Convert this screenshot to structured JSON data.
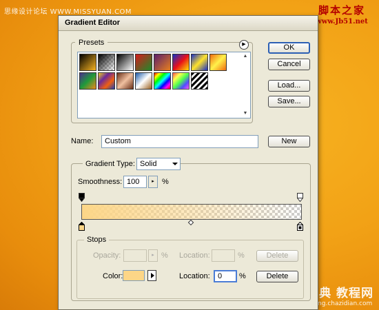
{
  "watermarks": {
    "top_left": "思缘设计论坛 WWW.MISSYUAN.COM",
    "top_right_big": "脚本之家",
    "top_right_small": "www.Jb51.net",
    "bottom_right_big": "查字典 教程网",
    "bottom_right_small": "jiaocheng.chazidian.com"
  },
  "dialog": {
    "title": "Gradient Editor",
    "presets": {
      "label": "Presets",
      "menu_icon": "circle-arrow-icon",
      "swatches": [
        {
          "name": "foreground-to-background",
          "colors": [
            "#000000",
            "#f7b321"
          ]
        },
        {
          "name": "foreground-to-transparent",
          "colors": [
            "#000000",
            "transparent"
          ]
        },
        {
          "name": "black-white",
          "colors": [
            "#000000",
            "#ffffff"
          ]
        },
        {
          "name": "red-green",
          "colors": [
            "#d41c1c",
            "#1e8a2a"
          ]
        },
        {
          "name": "violet-orange",
          "colors": [
            "#5a1f6b",
            "#e8801e"
          ]
        },
        {
          "name": "blue-red-yellow",
          "colors": [
            "#1030c8",
            "#e8101a",
            "#ffe200"
          ]
        },
        {
          "name": "blue-yellow-blue",
          "colors": [
            "#1a2ec6",
            "#ffe32a",
            "#1a2ec6"
          ]
        },
        {
          "name": "orange-yellow-orange",
          "colors": [
            "#f06b10",
            "#fff24a",
            "#f06b10"
          ]
        },
        {
          "name": "violet-green-orange",
          "colors": [
            "#4a2e8c",
            "#1f9a3a",
            "#f0881a"
          ]
        },
        {
          "name": "yellow-violet-orange-blue",
          "colors": [
            "#f0d020",
            "#6a2a9a",
            "#f06010",
            "#1f40b0"
          ]
        },
        {
          "name": "copper",
          "colors": [
            "#6a3018",
            "#f0c0a0",
            "#6a3018"
          ]
        },
        {
          "name": "chrome",
          "colors": [
            "#1c5aa8",
            "#ffffff",
            "#9a6020"
          ]
        },
        {
          "name": "spectrum",
          "colors": [
            "#ff0000",
            "#ffff00",
            "#00ff00",
            "#00ffff",
            "#0000ff",
            "#ff00ff",
            "#ff0000"
          ]
        },
        {
          "name": "transparent-rainbow",
          "colors": [
            "#ff3030",
            "#ffff30",
            "#30ff30",
            "#3030ff",
            "#ff30ff"
          ]
        },
        {
          "name": "transparent-stripes",
          "colors": [
            "#000000",
            "#ffffff"
          ]
        }
      ]
    },
    "buttons": {
      "ok": "OK",
      "cancel": "Cancel",
      "load": "Load...",
      "save": "Save...",
      "new": "New"
    },
    "name": {
      "label": "Name:",
      "value": "Custom"
    },
    "gradient_type": {
      "label": "Gradient Type:",
      "value": "Solid"
    },
    "smoothness": {
      "label": "Smoothness:",
      "value": "100",
      "unit": "%"
    },
    "gradient": {
      "start_color": "#fdd687",
      "end_color": "transparent"
    },
    "stops": {
      "label": "Stops",
      "opacity_label": "Opacity:",
      "opacity_value": "",
      "opacity_unit": "%",
      "opacity_location_label": "Location:",
      "opacity_location_value": "",
      "opacity_location_unit": "%",
      "opacity_delete": "Delete",
      "color_label": "Color:",
      "color_value": "#fdd687",
      "color_location_label": "Location:",
      "color_location_value": "0",
      "color_location_unit": "%",
      "color_delete": "Delete"
    }
  }
}
